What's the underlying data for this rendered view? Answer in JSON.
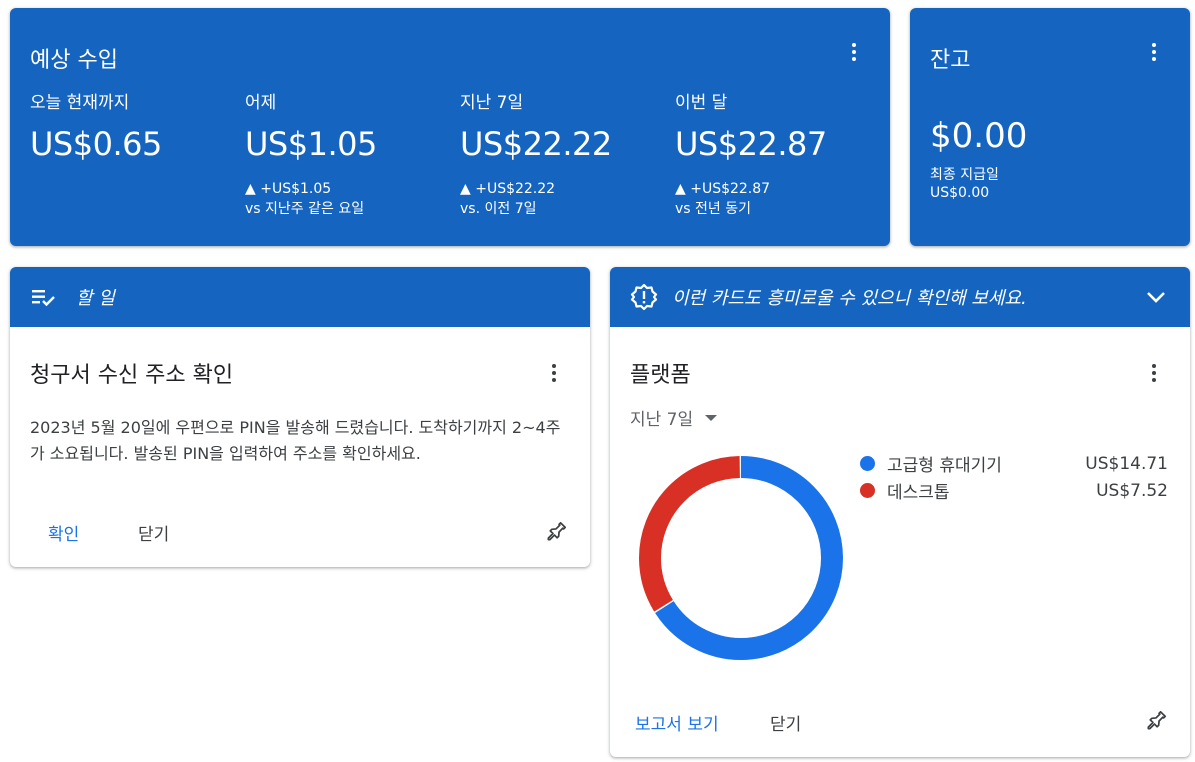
{
  "earnings": {
    "title": "예상 수입",
    "metrics": [
      {
        "label": "오늘 현재까지",
        "value": "US$0.65",
        "change": "",
        "compare": ""
      },
      {
        "label": "어제",
        "value": "US$1.05",
        "change": "▲ +US$1.05",
        "compare": "vs 지난주 같은 요일"
      },
      {
        "label": "지난 7일",
        "value": "US$22.22",
        "change": "▲ +US$22.22",
        "compare": "vs. 이전 7일"
      },
      {
        "label": "이번 달",
        "value": "US$22.87",
        "change": "▲ +US$22.87",
        "compare": "vs 전년 동기"
      }
    ]
  },
  "balance": {
    "title": "잔고",
    "amount": "$0.00",
    "last_payment_label": "최종 지급일",
    "last_payment_amount": "US$0.00"
  },
  "todo": {
    "header": "할 일",
    "title": "청구서 수신 주소 확인",
    "body": "2023년 5월 20일에 우편으로 PIN을 발송해 드렸습니다. 도착하기까지 2~4주가 소요됩니다. 발송된 PIN을 입력하여 주소를 확인하세요.",
    "confirm_label": "확인",
    "close_label": "닫기"
  },
  "platform": {
    "header": "이런 카드도 흥미로울 수 있으니 확인해 보세요.",
    "title": "플랫폼",
    "range": "지난 7일",
    "report_label": "보고서 보기",
    "close_label": "닫기",
    "legend": [
      {
        "name": "고급형 휴대기기",
        "amount": "US$14.71",
        "color": "#1a73e8"
      },
      {
        "name": "데스크톱",
        "amount": "US$7.52",
        "color": "#d93025"
      }
    ]
  },
  "chart_data": {
    "type": "pie",
    "categories": [
      "고급형 휴대기기",
      "데스크톱"
    ],
    "values": [
      14.71,
      7.52
    ],
    "colors": [
      "#1a73e8",
      "#d93025"
    ]
  }
}
